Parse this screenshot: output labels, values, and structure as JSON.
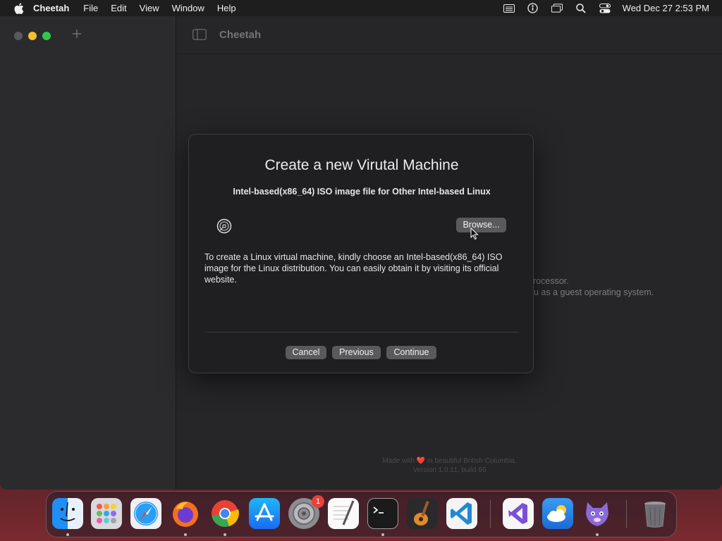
{
  "menubar": {
    "app_name": "Cheetah",
    "menus": [
      "File",
      "Edit",
      "View",
      "Window",
      "Help"
    ],
    "clock": "Wed Dec 27  2:53 PM"
  },
  "window": {
    "toolbar_title": "Cheetah",
    "background_text_line1": "rocessor.",
    "background_text_line2": "u as a guest operating system.",
    "footer_line1": "Made with ❤️ in beautiful British Columbia.",
    "footer_line2": "Version 1.0.11, build 66"
  },
  "dialog": {
    "title": "Create a new Virutal Machine",
    "subtitle": "Intel-based(x86_64) ISO image file for Other Intel-based Linux",
    "browse_label": "Browse...",
    "description": "To create a Linux virtual machine, kindly choose an Intel-based(x86_64) ISO image for the Linux distribution. You can easily obtain it by visiting its official website.",
    "cancel_label": "Cancel",
    "previous_label": "Previous",
    "continue_label": "Continue"
  },
  "dock": {
    "system_settings_badge": "1",
    "apps": [
      "finder-icon",
      "launchpad-icon",
      "safari-icon",
      "firefox-icon",
      "chrome-icon",
      "app-store-icon",
      "system-settings-icon",
      "textedit-icon",
      "terminal-icon",
      "garageband-icon",
      "vscode-icon",
      "visual-studio-icon",
      "weather-icon",
      "cheetah-icon",
      "trash-icon"
    ]
  },
  "colors": {
    "dialog_bg": "#1f1f21",
    "button_bg": "#5a5a5c",
    "traffic_min": "#f5bf30",
    "traffic_max": "#2ec94c"
  }
}
